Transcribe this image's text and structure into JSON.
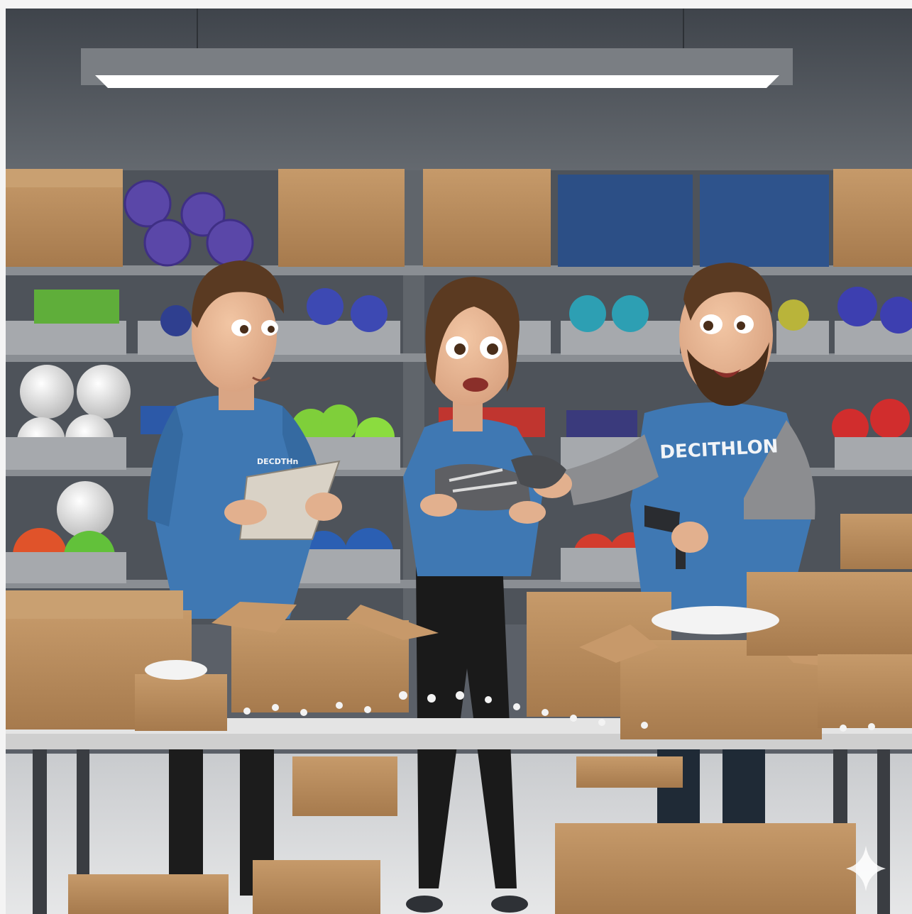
{
  "scene": {
    "description_label": "",
    "shirt_text_right": "DECITHLON",
    "shirt_text_left": "DECDTHn",
    "colors": {
      "wall": "#5b6068",
      "shelf": "#6f7378",
      "shirt_blue": "#3f78b3",
      "cardboard": "#b98b5c",
      "cardboard_dark": "#8f6a44",
      "table_top": "#e6e6e6",
      "floor": "#d9d9d9"
    },
    "icons": [
      "sparkle-icon"
    ]
  }
}
